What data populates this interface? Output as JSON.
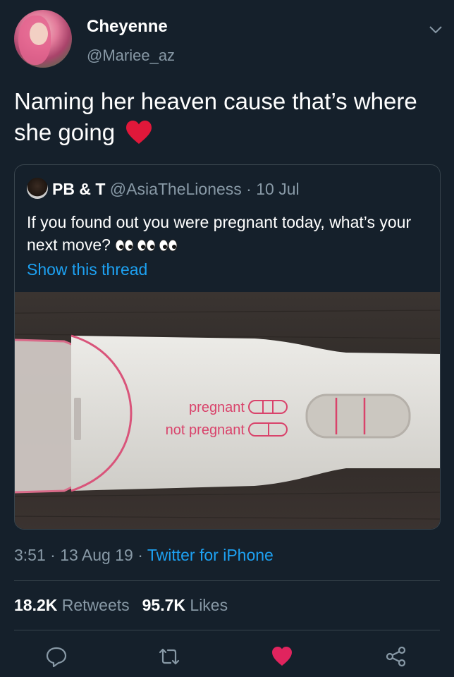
{
  "author": {
    "display_name": "Cheyenne",
    "handle": "@Mariee_az"
  },
  "tweet": {
    "text": "Naming her heaven cause that’s where she going",
    "emoji": "red-heart-emoji"
  },
  "quoted_tweet": {
    "display_name": "PB & T",
    "handle": "@AsiaTheLioness",
    "separator": " · ",
    "date": "10 Jul",
    "text": "If you found out you were pregnant today, what’s your next move?",
    "emoji": "eyes-emoji-x3",
    "show_thread": "Show this thread",
    "photo": {
      "label_pregnant": "pregnant",
      "label_not_pregnant": "not pregnant"
    }
  },
  "meta": {
    "time": "3:51",
    "sep1": " · ",
    "date": "13 Aug 19",
    "sep2": " · ",
    "source": "Twitter for iPhone"
  },
  "stats": {
    "retweets_count": "18.2K",
    "retweets_label": "Retweets",
    "likes_count": "95.7K",
    "likes_label": "Likes"
  },
  "colors": {
    "background": "#15202b",
    "accent": "#1da1f2",
    "secondary_text": "#8899a6",
    "like": "#e0245e",
    "divider": "#38444d"
  },
  "icons": {
    "reply": "reply-icon",
    "retweet": "retweet-icon",
    "like": "heart-icon",
    "share": "share-icon",
    "menu": "chevron-down-icon"
  }
}
